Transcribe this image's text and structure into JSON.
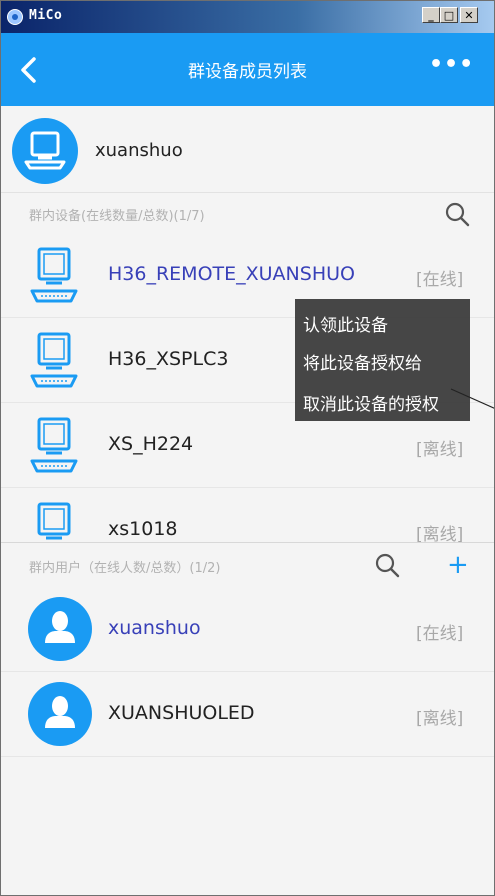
{
  "window": {
    "title": "MiCo",
    "minimize_label": "_",
    "maximize_label": "□",
    "close_label": "✕"
  },
  "header": {
    "title": "群设备成员列表",
    "more_label": "•••"
  },
  "owner": {
    "name": "xuanshuo"
  },
  "devices_section": {
    "label": "群内设备(在线数量/总数)(1/7)",
    "items": [
      {
        "name": "H36_REMOTE_XUANSHUO",
        "status": "[在线]"
      },
      {
        "name": "H36_XSPLC3",
        "status": ""
      },
      {
        "name": "XS_H224",
        "status": "[离线]"
      },
      {
        "name": "xs1018",
        "status": "[离线]"
      }
    ]
  },
  "users_section": {
    "label": "群内用户（在线人数/总数）(1/2)",
    "add_label": "+",
    "items": [
      {
        "name": "xuanshuo",
        "status": "[在线]"
      },
      {
        "name": "XUANSHUOLED",
        "status": "[离线]"
      }
    ]
  },
  "context_menu": {
    "items": [
      "认领此设备",
      "将此设备授权给",
      "取消此设备的授权"
    ]
  },
  "colors": {
    "accent": "#1a9bf3",
    "online_text": "#3840b8",
    "status_text": "#a8a8a8"
  }
}
